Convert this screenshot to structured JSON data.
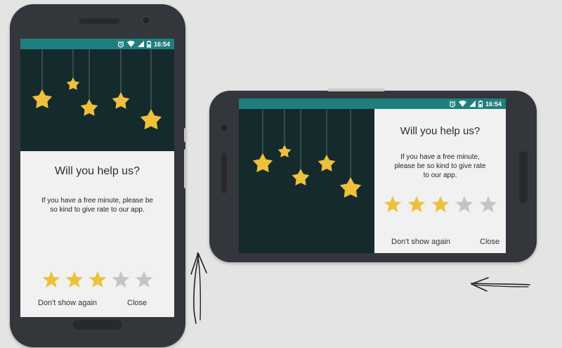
{
  "status_bar": {
    "time": "16:54",
    "icons": [
      "alarm-icon",
      "wifi-icon",
      "signal-icon",
      "battery-icon"
    ]
  },
  "dialog": {
    "title": "Will you help us?",
    "message_portrait_lines": [
      "If you have a free minute, please be",
      "so kind to give rate to our app."
    ],
    "message_landscape_lines": [
      "If you have a free minute,",
      "please be so kind to give rate",
      "to our app."
    ],
    "rating": {
      "value": 3,
      "max": 5
    },
    "dont_show_label": "Don't show again",
    "close_label": "Close"
  },
  "colors": {
    "status_bar": "#1f7f7e",
    "sky": "#142a2d",
    "star_active": "#eec03b",
    "star_inactive": "#c4c4c4",
    "dialog_bg": "#f1f1f1",
    "phone_body": "#33363b"
  }
}
